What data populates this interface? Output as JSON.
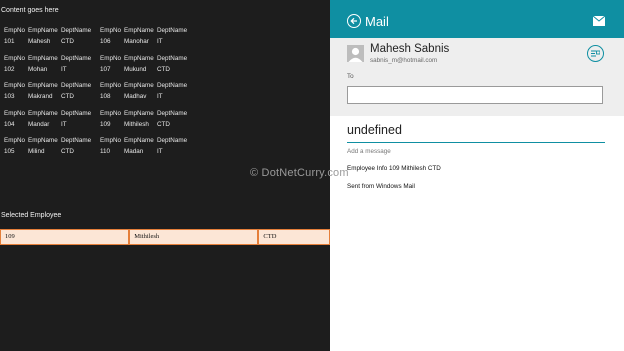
{
  "app": {
    "heading": "Content goes here",
    "columns": [
      "EmpNo",
      "EmpName",
      "DeptName"
    ],
    "employees": [
      {
        "no": "101",
        "name": "Mahesh",
        "dept": "CTD"
      },
      {
        "no": "102",
        "name": "Mohan",
        "dept": "IT"
      },
      {
        "no": "103",
        "name": "Makrand",
        "dept": "CTD"
      },
      {
        "no": "104",
        "name": "Mandar",
        "dept": "IT"
      },
      {
        "no": "105",
        "name": "Milind",
        "dept": "CTD"
      },
      {
        "no": "106",
        "name": "Manohar",
        "dept": "IT"
      },
      {
        "no": "107",
        "name": "Mukund",
        "dept": "CTD"
      },
      {
        "no": "108",
        "name": "Madhav",
        "dept": "IT"
      },
      {
        "no": "109",
        "name": "Mithilesh",
        "dept": "CTD"
      },
      {
        "no": "110",
        "name": "Madan",
        "dept": "IT"
      }
    ],
    "selected_label": "Selected Employee",
    "selected": {
      "no": "109",
      "name": "Mithilesh",
      "dept": "CTD"
    }
  },
  "mail": {
    "title": "Mail",
    "sender_name": "Mahesh Sabnis",
    "sender_email": "sabnis_m@hotmail.com",
    "to_label": "To",
    "to_value": "",
    "subject": "undefined",
    "message_placeholder": "Add a message",
    "body_line_1": "Employee Info 109 Mithilesh CTD",
    "body_line_2": "Sent from Windows Mail",
    "accent_color": "#0f8fa2",
    "icons": {
      "back": "back-arrow-icon",
      "send": "envelope-icon",
      "accounts": "switch-account-icon"
    }
  },
  "watermark": "© DotNetCurry.com"
}
